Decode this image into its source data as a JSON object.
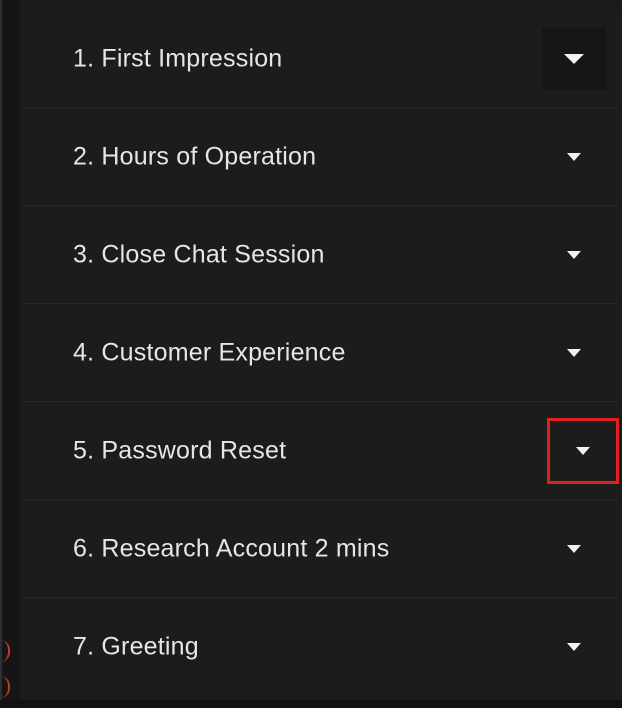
{
  "accordion": {
    "items": [
      {
        "label": "1. First Impression"
      },
      {
        "label": "2. Hours of Operation"
      },
      {
        "label": "3. Close Chat Session"
      },
      {
        "label": "4. Customer Experience"
      },
      {
        "label": "5. Password Reset",
        "highlighted": true
      },
      {
        "label": "6. Research Account 2 mins"
      },
      {
        "label": "7. Greeting"
      }
    ],
    "toggle_icon": "caret-down-icon",
    "highlight_color": "#e0201f",
    "panel_color": "#1c1c1c",
    "text_color": "#e6e6e6"
  }
}
